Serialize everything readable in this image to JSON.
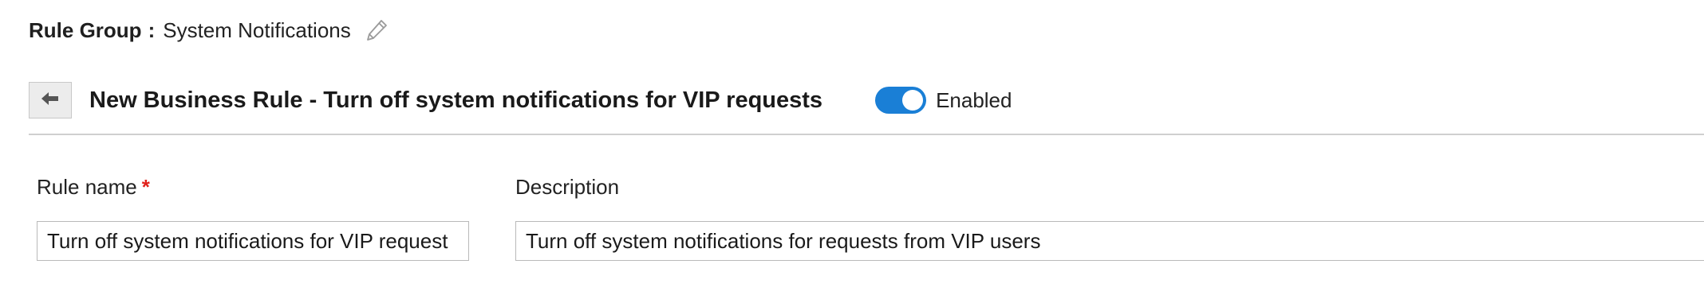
{
  "rule_group": {
    "label": "Rule Group",
    "separator": ":",
    "value": "System Notifications"
  },
  "header": {
    "title": "New Business Rule - Turn off system notifications for VIP requests",
    "toggle": {
      "state": "on",
      "label": "Enabled"
    }
  },
  "form": {
    "rule_name": {
      "label": "Rule name",
      "required_marker": "*",
      "value": "Turn off system notifications for VIP request"
    },
    "description": {
      "label": "Description",
      "value": "Turn off system notifications for requests from VIP users"
    }
  },
  "colors": {
    "accent": "#1a7fd6",
    "required": "#e0201a",
    "divider": "#cfcfcf"
  },
  "icons": [
    "pencil-icon",
    "arrow-left-icon"
  ]
}
